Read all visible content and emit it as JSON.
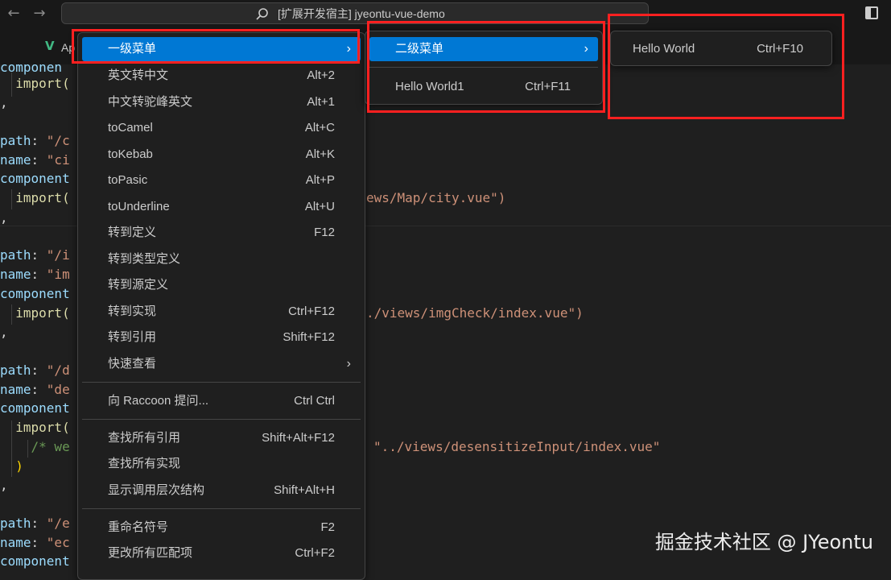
{
  "titlebar": {
    "back_icon": "arrow-left-icon",
    "forward_icon": "arrow-right-icon",
    "search_text": "[扩展开发宿主] jyeontu-vue-demo",
    "layout_icon": "toggle-panel-icon"
  },
  "tab": {
    "label": "Ap"
  },
  "code": {
    "l1": "componen",
    "l2": "  import(",
    "l3": ",",
    "l4a": "path",
    "l4b": ": ",
    "l4c": "\"/c",
    "l5a": "name",
    "l5b": ": ",
    "l5c": "\"ci",
    "l6": "component",
    "l7a": "  import(",
    "l7b": "ews/Map/city.vue\")",
    "l8": ",",
    "l9a": "path",
    "l9b": ": ",
    "l9c": "\"/i",
    "l10a": "name",
    "l10b": ": ",
    "l10c": "\"im",
    "l11": "component",
    "l12a": "  import(",
    "l12b": "./views/imgCheck/index.vue\")",
    "l13": ",",
    "l14a": "path",
    "l14b": ": ",
    "l14c": "\"/d",
    "l15a": "name",
    "l15b": ": ",
    "l15c": "\"de",
    "l16": "component",
    "l17": "  import(",
    "l18a": "    /* we",
    "l18b": "\"../views/desensitizeInput/index.vue\"",
    "l19": "  )",
    "l20": ",",
    "l21a": "path",
    "l21b": ": ",
    "l21c": "\"/e",
    "l22a": "name",
    "l22b": ": ",
    "l22c": "\"ec",
    "l23": "component"
  },
  "menu1": {
    "items": [
      {
        "label": "一级菜单",
        "kb": "",
        "submenu": true
      },
      {
        "label": "英文转中文",
        "kb": "Alt+2"
      },
      {
        "label": "中文转驼峰英文",
        "kb": "Alt+1"
      },
      {
        "label": "toCamel",
        "kb": "Alt+C"
      },
      {
        "label": "toKebab",
        "kb": "Alt+K"
      },
      {
        "label": "toPasic",
        "kb": "Alt+P"
      },
      {
        "label": "toUnderline",
        "kb": "Alt+U"
      },
      {
        "label": "转到定义",
        "kb": "F12"
      },
      {
        "label": "转到类型定义",
        "kb": ""
      },
      {
        "label": "转到源定义",
        "kb": ""
      },
      {
        "label": "转到实现",
        "kb": "Ctrl+F12"
      },
      {
        "label": "转到引用",
        "kb": "Shift+F12"
      },
      {
        "label": "快速查看",
        "kb": "",
        "submenu": true
      },
      {
        "label": "向 Raccoon 提问...",
        "kb": "Ctrl Ctrl"
      },
      {
        "label": "查找所有引用",
        "kb": "Shift+Alt+F12"
      },
      {
        "label": "查找所有实现",
        "kb": ""
      },
      {
        "label": "显示调用层次结构",
        "kb": "Shift+Alt+H"
      },
      {
        "label": "重命名符号",
        "kb": "F2"
      },
      {
        "label": "更改所有匹配项",
        "kb": "Ctrl+F2"
      }
    ]
  },
  "menu2": {
    "items": [
      {
        "label": "二级菜单",
        "kb": "",
        "submenu": true
      },
      {
        "label": "Hello World1",
        "kb": "Ctrl+F11"
      }
    ]
  },
  "menu3": {
    "items": [
      {
        "label": "Hello World",
        "kb": "Ctrl+F10"
      }
    ]
  },
  "icons": {
    "submenu_arrow": "chevron-right-icon"
  },
  "colors": {
    "accent": "#0078d4",
    "highlight_box": "#ff2020"
  },
  "watermark": "掘金技术社区 @ JYeontu"
}
